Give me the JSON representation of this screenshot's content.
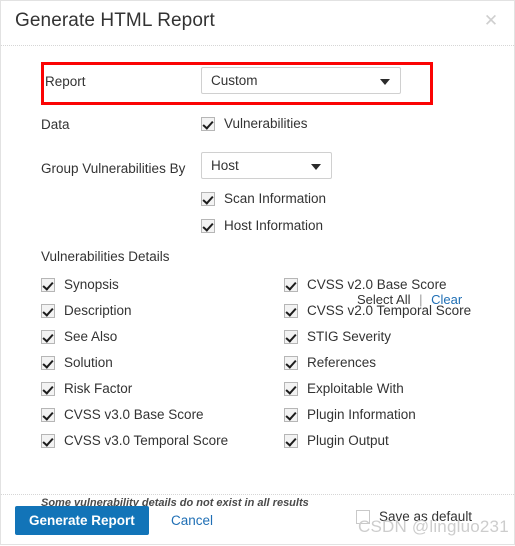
{
  "dialog": {
    "title": "Generate HTML Report",
    "close_icon": "close-icon",
    "close_glyph": "✕"
  },
  "report_field": {
    "label": "Report",
    "value": "Custom",
    "options": [
      "Custom"
    ],
    "highlighted": true,
    "highlight_color": "#fb0303"
  },
  "data_field": {
    "label": "Data",
    "checkbox": {
      "label": "Vulnerabilities",
      "checked": true
    }
  },
  "group_field": {
    "label": "Group Vulnerabilities By",
    "value": "Host",
    "options": [
      "Host"
    ],
    "extra_checkboxes": [
      {
        "label": "Scan Information",
        "checked": true
      },
      {
        "label": "Host Information",
        "checked": true
      }
    ]
  },
  "details_section": {
    "title": "Vulnerabilities Details",
    "select_all_label": "Select All",
    "separator": "|",
    "clear_label": "Clear",
    "left_column": [
      {
        "label": "Synopsis",
        "checked": true
      },
      {
        "label": "Description",
        "checked": true
      },
      {
        "label": "See Also",
        "checked": true
      },
      {
        "label": "Solution",
        "checked": true
      },
      {
        "label": "Risk Factor",
        "checked": true
      },
      {
        "label": "CVSS v3.0 Base Score",
        "checked": true
      },
      {
        "label": "CVSS v3.0 Temporal Score",
        "checked": true
      }
    ],
    "right_column": [
      {
        "label": "CVSS v2.0 Base Score",
        "checked": true
      },
      {
        "label": "CVSS v2.0 Temporal Score",
        "checked": true
      },
      {
        "label": "STIG Severity",
        "checked": true
      },
      {
        "label": "References",
        "checked": true
      },
      {
        "label": "Exploitable With",
        "checked": true
      },
      {
        "label": "Plugin Information",
        "checked": true
      },
      {
        "label": "Plugin Output",
        "checked": true
      }
    ],
    "note": "Some vulnerability details do not exist in all results"
  },
  "footer": {
    "generate_label": "Generate Report",
    "cancel_label": "Cancel",
    "save_default": {
      "label": "Save as default",
      "checked": false
    },
    "accent_color": "#1274b8",
    "link_color": "#1f6fb5"
  },
  "watermark": {
    "text": "CSDN @lingluo231"
  }
}
